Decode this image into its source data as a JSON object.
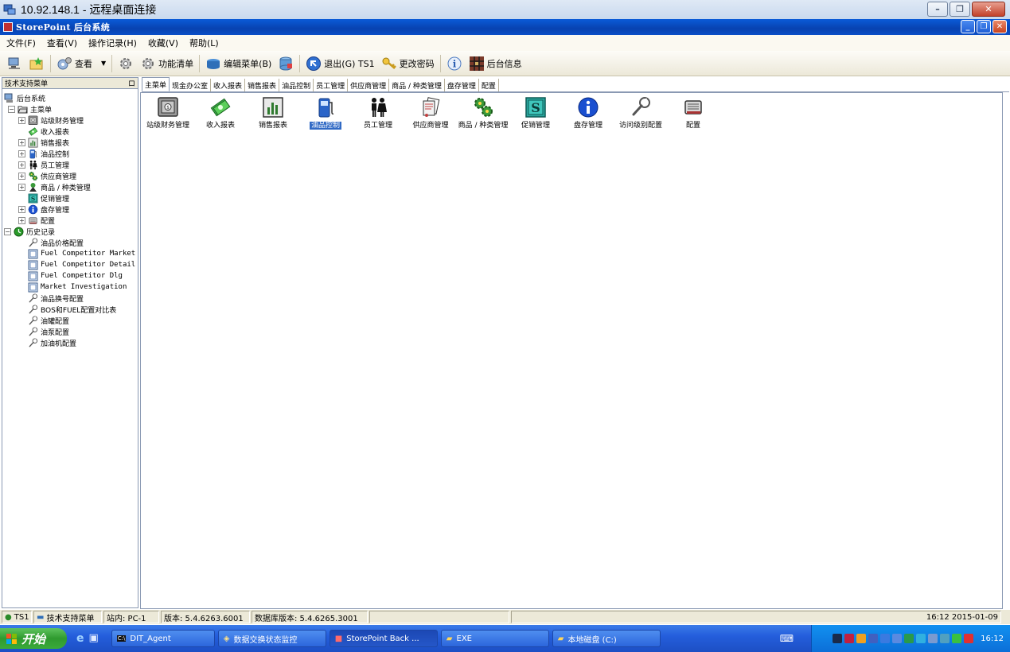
{
  "rdp": {
    "title": "10.92.148.1 - 远程桌面连接"
  },
  "app": {
    "title": "StorePoint 后台系统"
  },
  "menu": [
    "文件(F)",
    "查看(V)",
    "操作记录(H)",
    "收藏(V)",
    "帮助(L)"
  ],
  "toolbar": {
    "view_label": "查看",
    "function_list_label": "功能清单",
    "edit_menu_label": "编辑菜单(B)",
    "exit_label": "退出(G) TS1",
    "change_password_label": "更改密码",
    "backoffice_info_label": "后台信息"
  },
  "left_panel": {
    "header": "技术支持菜单",
    "pin_glyph": "ロ",
    "tree": [
      {
        "label": "后台系统",
        "level": 0,
        "expander": "",
        "icon": "computer-icon"
      },
      {
        "label": "主菜单",
        "level": 1,
        "expander": "−",
        "icon": "folder-icon"
      },
      {
        "label": "站级财务管理",
        "level": 2,
        "expander": "+",
        "icon": "safe-icon"
      },
      {
        "label": "收入报表",
        "level": 2,
        "expander": "",
        "icon": "money-icon"
      },
      {
        "label": "销售报表",
        "level": 2,
        "expander": "+",
        "icon": "bar-chart-icon"
      },
      {
        "label": "油品控制",
        "level": 2,
        "expander": "+",
        "icon": "fuel-pump-icon"
      },
      {
        "label": "员工管理",
        "level": 2,
        "expander": "+",
        "icon": "people-icon"
      },
      {
        "label": "供应商管理",
        "level": 2,
        "expander": "+",
        "icon": "gears-icon"
      },
      {
        "label": "商品 / 种类管理",
        "level": 2,
        "expander": "+",
        "icon": "product-icon"
      },
      {
        "label": "促销管理",
        "level": 2,
        "expander": "",
        "icon": "promo-icon"
      },
      {
        "label": "盘存管理",
        "level": 2,
        "expander": "+",
        "icon": "info-icon"
      },
      {
        "label": "配置",
        "level": 2,
        "expander": "+",
        "icon": "config-icon"
      },
      {
        "label": "历史记录",
        "level": 0,
        "expander": "−",
        "icon": "history-icon"
      },
      {
        "label": "油品价格配置",
        "level": 2,
        "expander": "",
        "icon": "wrench-icon"
      },
      {
        "label": "Fuel Competitor Market",
        "level": 2,
        "expander": "",
        "icon": "form-icon"
      },
      {
        "label": "Fuel Competitor Detail",
        "level": 2,
        "expander": "",
        "icon": "form-icon"
      },
      {
        "label": "Fuel Competitor Dlg",
        "level": 2,
        "expander": "",
        "icon": "form-icon"
      },
      {
        "label": "Market Investigation",
        "level": 2,
        "expander": "",
        "icon": "form-icon"
      },
      {
        "label": "油品换号配置",
        "level": 2,
        "expander": "",
        "icon": "wrench-icon"
      },
      {
        "label": "BOS和FUEL配置对比表",
        "level": 2,
        "expander": "",
        "icon": "wrench-icon"
      },
      {
        "label": "油罐配置",
        "level": 2,
        "expander": "",
        "icon": "wrench-icon"
      },
      {
        "label": "油泵配置",
        "level": 2,
        "expander": "",
        "icon": "wrench-icon"
      },
      {
        "label": "加油机配置",
        "level": 2,
        "expander": "",
        "icon": "wrench-icon"
      }
    ]
  },
  "tabs": [
    "主菜单",
    "现金办公室",
    "收入报表",
    "销售报表",
    "油品控制",
    "员工管理",
    "供应商管理",
    "商品 / 种类管理",
    "盘存管理",
    "配置"
  ],
  "modules": [
    {
      "label": "站级财务管理",
      "icon": "safe-icon"
    },
    {
      "label": "收入报表",
      "icon": "money-icon"
    },
    {
      "label": "销售报表",
      "icon": "bar-chart-icon"
    },
    {
      "label": "油品控制",
      "icon": "fuel-pump-icon",
      "selected": true
    },
    {
      "label": "员工管理",
      "icon": "people-icon"
    },
    {
      "label": "供应商管理",
      "icon": "documents-icon"
    },
    {
      "label": "商品 / 种类管理",
      "icon": "gears-icon"
    },
    {
      "label": "促销管理",
      "icon": "promo-icon"
    },
    {
      "label": "盘存管理",
      "icon": "info-icon"
    },
    {
      "label": "访问级别配置",
      "icon": "wrench-icon"
    },
    {
      "label": "配置",
      "icon": "config-icon"
    }
  ],
  "statusbar": {
    "user": "TS1",
    "menu": "技术支持菜单",
    "station": "站内: PC-1",
    "version": "版本: 5.4.6263.6001",
    "db_version": "数据库版本: 5.4.6265.3001",
    "datetime": "16:12 2015-01-09"
  },
  "taskbar": {
    "start": "开始",
    "tasks": [
      "DIT_Agent",
      "数据交换状态监控",
      "StorePoint Back ...",
      "EXE",
      "本地磁盘 (C:)"
    ],
    "clock": "16:12"
  }
}
